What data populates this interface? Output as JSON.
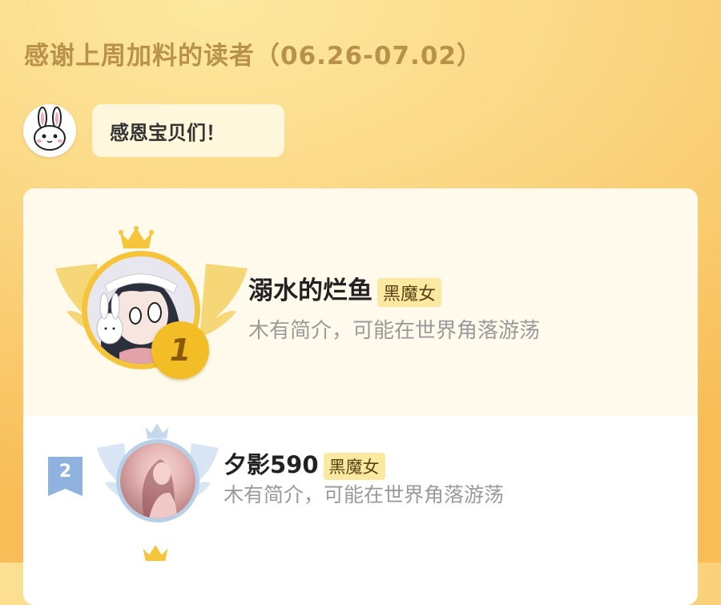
{
  "header": {
    "title": "感谢上周加料的读者（06.26-07.02）"
  },
  "greeting": {
    "text": "感恩宝贝们！"
  },
  "leaderboard": {
    "first": {
      "rank": "1",
      "name": "溺水的烂鱼",
      "tag": "黑魔女",
      "bio": "木有简介，可能在世界角落游荡"
    },
    "second": {
      "rank": "2",
      "name": "夕影590",
      "tag": "黑魔女",
      "bio": "木有简介，可能在世界角落游荡"
    }
  },
  "colors": {
    "gold": "#f3bd25",
    "silver": "#b8cfe8",
    "title": "#b9924a"
  }
}
